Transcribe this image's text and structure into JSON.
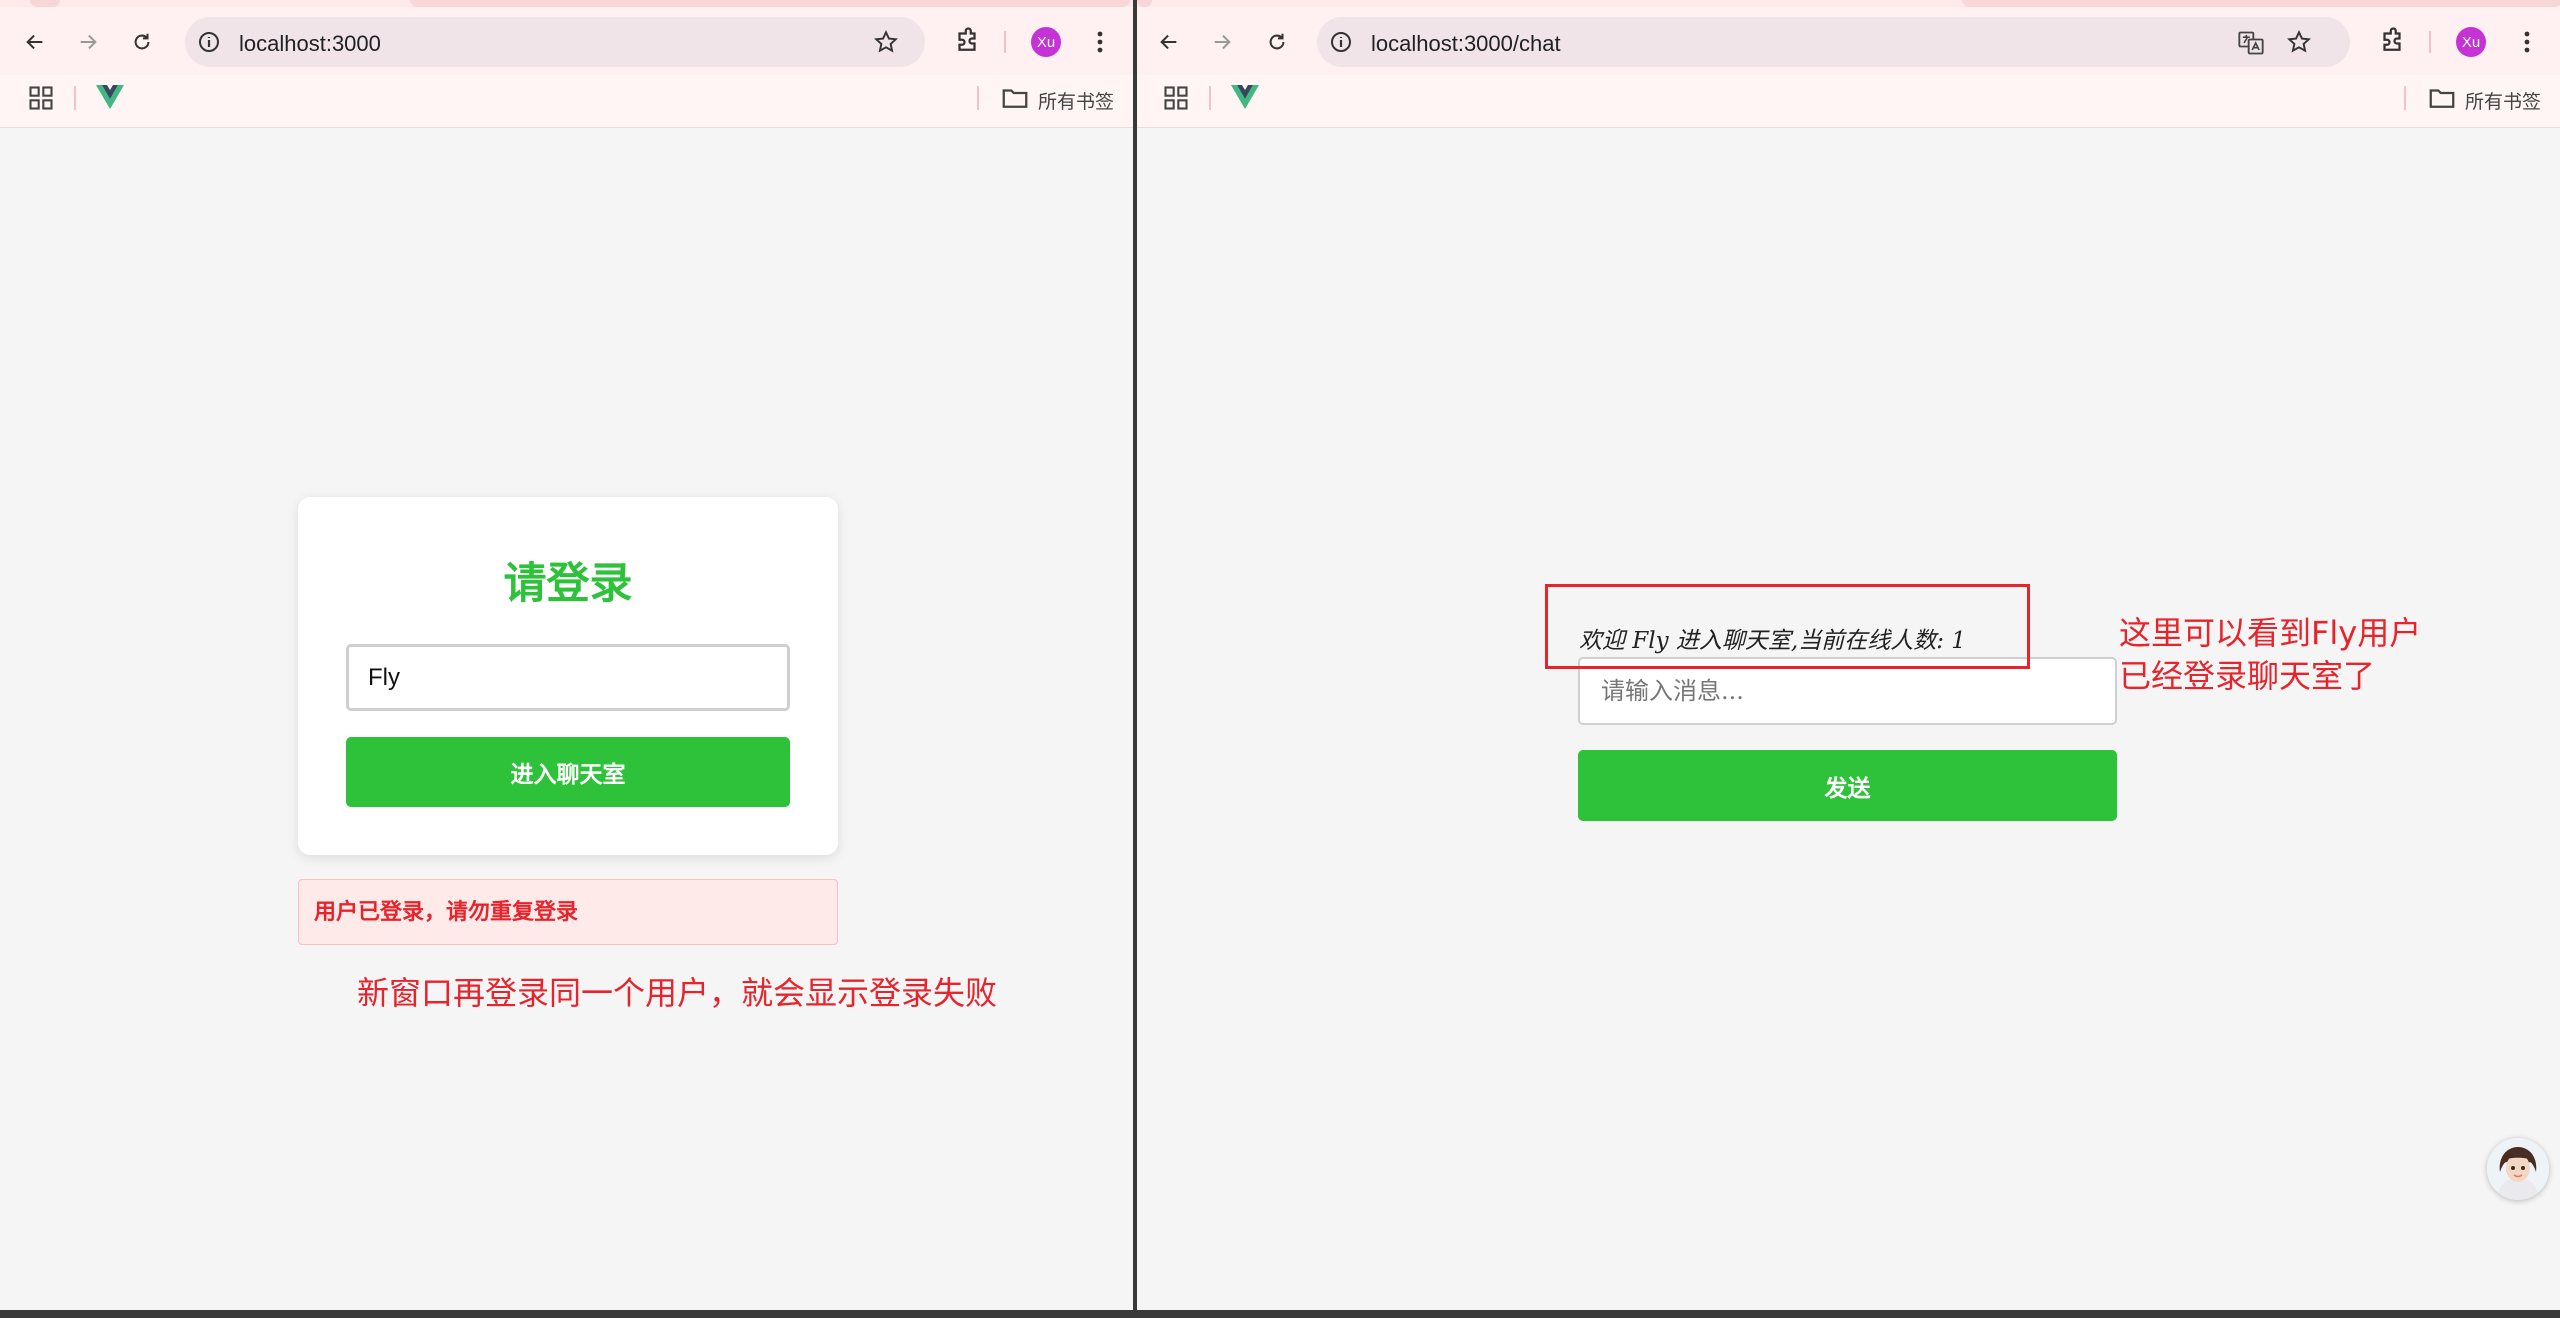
{
  "left_window": {
    "address_bar": {
      "url": "localhost:3000"
    },
    "profile_avatar": "Xu",
    "bookmarks_bar": {
      "all_bookmarks": "所有书签"
    },
    "login_card": {
      "title": "请登录",
      "username_value": "Fly",
      "submit_label": "进入聊天室"
    },
    "error_message": "用户已登录，请勿重复登录",
    "annotation": "新窗口再登录同一个用户，就会显示登录失败"
  },
  "right_window": {
    "address_bar": {
      "url": "localhost:3000/chat"
    },
    "profile_avatar": "Xu",
    "bookmarks_bar": {
      "all_bookmarks": "所有书签"
    },
    "chat": {
      "welcome_text": "欢迎 Fly 进入聊天室,当前在线人数: 1",
      "message_placeholder": "请输入消息...",
      "send_label": "发送"
    },
    "annotation_line1": "这里可以看到Fly用户",
    "annotation_line2": "已经登录聊天室了"
  },
  "colors": {
    "accent_green": "#2ec23a",
    "error_red": "#e7242c",
    "avatar_purple": "#c532d6"
  },
  "icons": [
    "back-arrow-icon",
    "forward-arrow-icon",
    "reload-icon",
    "info-icon",
    "star-icon",
    "translate-icon",
    "extensions-icon",
    "menu-dots-icon",
    "apps-grid-icon",
    "vue-logo-icon",
    "folder-icon",
    "assistant-avatar-icon"
  ]
}
